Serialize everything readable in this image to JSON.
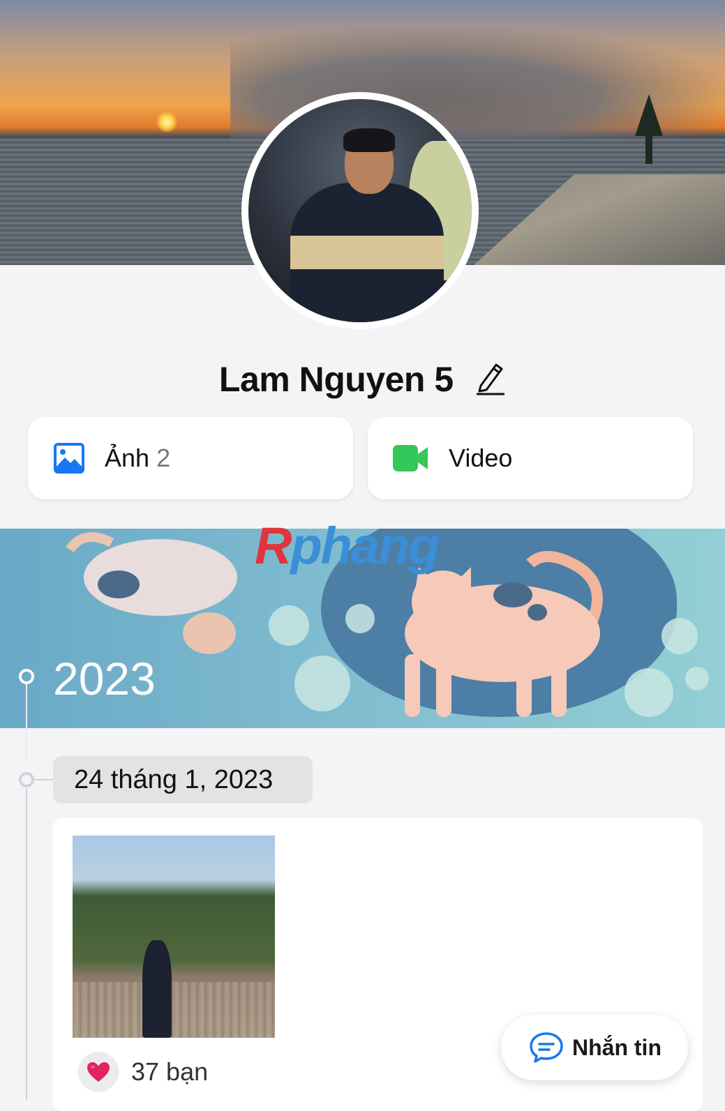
{
  "profile": {
    "name": "Lam Nguyen 5"
  },
  "media": {
    "photos_label": "Ảnh",
    "photos_count": "2",
    "video_label": "Video"
  },
  "timeline": {
    "year": "2023",
    "date": "24 tháng 1, 2023"
  },
  "watermark": {
    "first": "R",
    "rest": "phang"
  },
  "post": {
    "likes": "37 bạn"
  },
  "message_button": {
    "label": "Nhắn tin"
  },
  "colors": {
    "photo_icon": "#1877f2",
    "video_icon": "#34c759",
    "message_icon": "#1877f2",
    "heart": "#e0245e"
  },
  "icons": {
    "edit": "pencil-icon",
    "photos": "image-icon",
    "video": "video-camera-icon",
    "heart": "heart-icon",
    "message": "chat-bubble-icon"
  }
}
